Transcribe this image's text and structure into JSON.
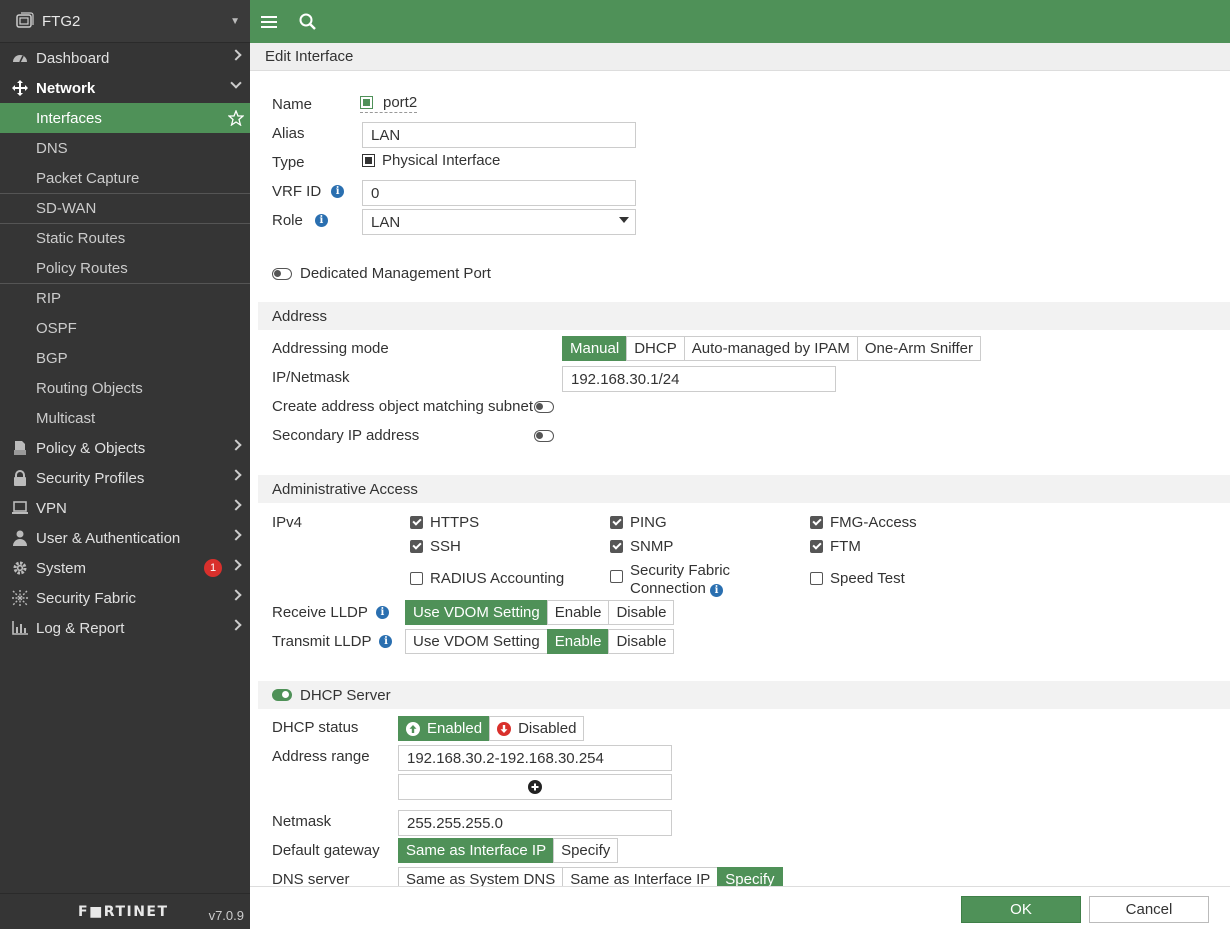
{
  "sidebar": {
    "device_name": "FTG2",
    "items": [
      {
        "label": "Dashboard",
        "icon": "dashboard-icon"
      },
      {
        "label": "Network",
        "icon": "network-icon"
      },
      {
        "label": "Policy & Objects",
        "icon": "policy-icon"
      },
      {
        "label": "Security Profiles",
        "icon": "lock-icon"
      },
      {
        "label": "VPN",
        "icon": "monitor-icon"
      },
      {
        "label": "User & Authentication",
        "icon": "user-icon"
      },
      {
        "label": "System",
        "icon": "gear-icon",
        "badge": "1"
      },
      {
        "label": "Security Fabric",
        "icon": "fabric-icon"
      },
      {
        "label": "Log & Report",
        "icon": "chart-icon"
      }
    ],
    "network_sub": [
      "Interfaces",
      "DNS",
      "Packet Capture",
      "SD-WAN",
      "Static Routes",
      "Policy Routes",
      "RIP",
      "OSPF",
      "BGP",
      "Routing Objects",
      "Multicast"
    ],
    "footer_logo": "F■RTINET",
    "version": "v7.0.9"
  },
  "page_title": "Edit Interface",
  "form": {
    "name_label": "Name",
    "name_value": "port2",
    "alias_label": "Alias",
    "alias_value": "LAN",
    "type_label": "Type",
    "type_value": "Physical Interface",
    "vrf_label": "VRF ID",
    "vrf_value": "0",
    "role_label": "Role",
    "role_value": "LAN",
    "dedicated_mgmt_label": "Dedicated Management Port"
  },
  "address": {
    "section_title": "Address",
    "mode_label": "Addressing mode",
    "modes": [
      "Manual",
      "DHCP",
      "Auto-managed by IPAM",
      "One-Arm Sniffer"
    ],
    "selected_mode": "Manual",
    "ip_label": "IP/Netmask",
    "ip_value": "192.168.30.1/24",
    "create_obj_label": "Create address object matching subnet",
    "secondary_label": "Secondary IP address"
  },
  "admin": {
    "section_title": "Administrative Access",
    "ipv4_label": "IPv4",
    "checks": {
      "https": "HTTPS",
      "ping": "PING",
      "fmg": "FMG-Access",
      "ssh": "SSH",
      "snmp": "SNMP",
      "ftm": "FTM",
      "radius": "RADIUS Accounting",
      "sfc1": "Security Fabric",
      "sfc2": "Connection",
      "speed": "Speed Test"
    },
    "receive_lldp_label": "Receive LLDP",
    "transmit_lldp_label": "Transmit LLDP",
    "lldp_options": [
      "Use VDOM Setting",
      "Enable",
      "Disable"
    ]
  },
  "dhcp": {
    "section_title": "DHCP Server",
    "status_label": "DHCP status",
    "enabled_label": "Enabled",
    "disabled_label": "Disabled",
    "range_label": "Address range",
    "range_value": "192.168.30.2-192.168.30.254",
    "netmask_label": "Netmask",
    "netmask_value": "255.255.255.0",
    "gateway_label": "Default gateway",
    "gateway_options": [
      "Same as Interface IP",
      "Specify"
    ],
    "dns_label": "DNS server",
    "dns_options": [
      "Same as System DNS",
      "Same as Interface IP",
      "Specify"
    ]
  },
  "footer": {
    "ok_label": "OK",
    "cancel_label": "Cancel"
  },
  "colors": {
    "accent": "#4f9158",
    "sidebar_bg": "#353535",
    "badge": "#d9302c",
    "info": "#2a6fb0"
  }
}
